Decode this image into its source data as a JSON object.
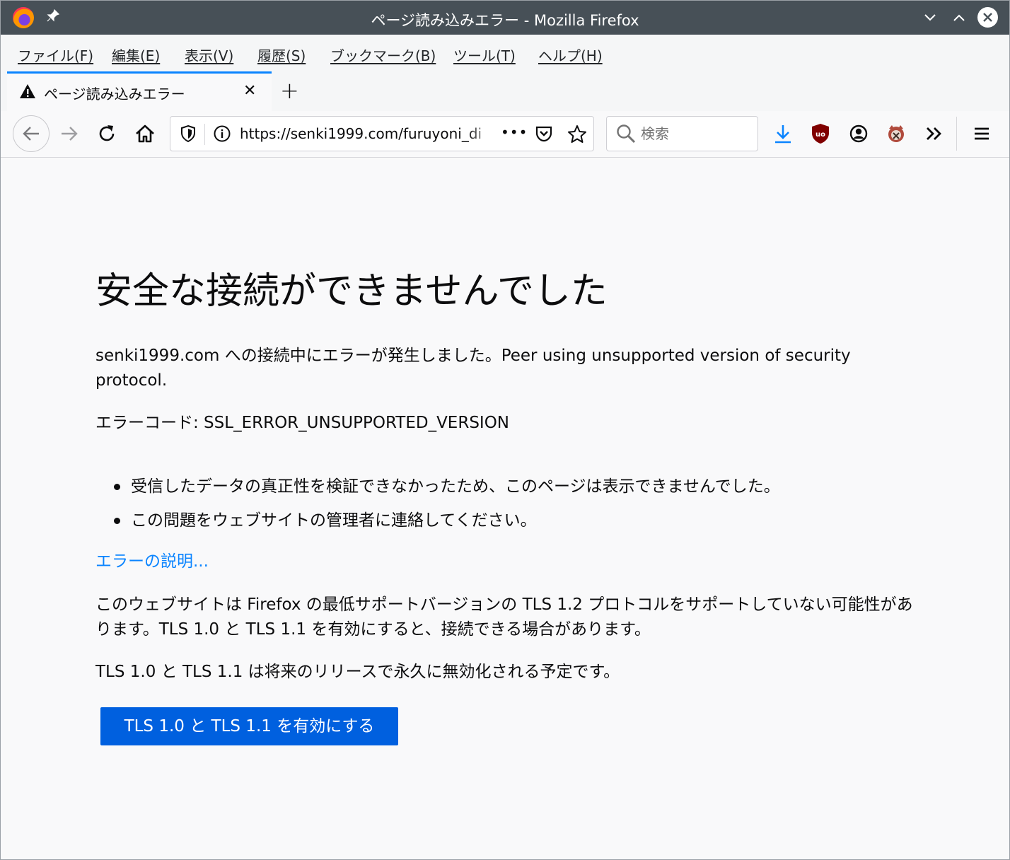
{
  "window": {
    "title": "ページ読み込みエラー - Mozilla Firefox"
  },
  "menu": {
    "items": [
      "ファイル(F)",
      "編集(E)",
      "表示(V)",
      "履歴(S)",
      "ブックマーク(B)",
      "ツール(T)",
      "ヘルプ(H)"
    ]
  },
  "tab": {
    "title": "ページ読み込みエラー",
    "close_glyph": "✕",
    "new_tab_glyph": "+"
  },
  "nav": {
    "url": "https://senki1999.com/furuyoni_di",
    "page_actions_glyph": "•••",
    "search_placeholder": "検索"
  },
  "error_page": {
    "title": "安全な接続ができませんでした",
    "description": "senki1999.com への接続中にエラーが発生しました。Peer using unsupported version of security protocol.",
    "error_code": "エラーコード: SSL_ERROR_UNSUPPORTED_VERSION",
    "bullets": [
      "受信したデータの真正性を検証できなかったため、このページは表示できませんでした。",
      "この問題をウェブサイトの管理者に連絡してください。"
    ],
    "learn_more": "エラーの説明...",
    "tls_explanation": "このウェブサイトは Firefox の最低サポートバージョンの TLS 1.2 プロトコルをサポートしていない可能性があります。TLS 1.0 と TLS 1.1 を有効にすると、接続できる場合があります。",
    "tls_deprecation": "TLS 1.0 と TLS 1.1 は将来のリリースで永久に無効化される予定です。",
    "enable_button": "TLS 1.0 と TLS 1.1 を有効にする"
  },
  "colors": {
    "titlebar": "#475057",
    "accent": "#0a84ff",
    "primary_button": "#0060df",
    "page_background": "#f9f9fa"
  },
  "icons": [
    "firefox-logo",
    "pin-icon",
    "minimize-icon",
    "maximize-icon",
    "close-window-icon",
    "warning-icon",
    "back-icon",
    "forward-icon",
    "reload-icon",
    "home-icon",
    "tracking-shield-icon",
    "info-icon",
    "pocket-icon",
    "bookmark-star-icon",
    "search-icon",
    "download-icon",
    "ublock-origin-icon",
    "account-icon",
    "extension-icon",
    "overflow-icon",
    "hamburger-menu-icon"
  ]
}
